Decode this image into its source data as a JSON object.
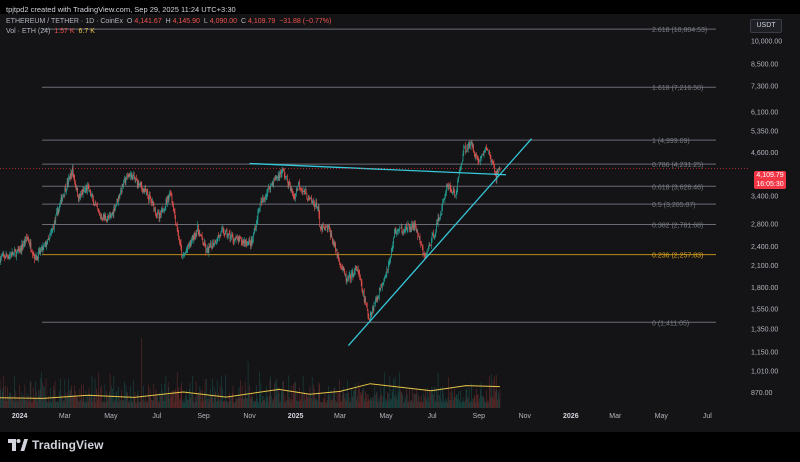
{
  "header": {
    "attribution": "tpjtpd2 created with TradingView.com, Sep 29, 2025 11:24 UTC+3:30"
  },
  "legend": {
    "symbol": "ETHEREUM / TETHER · 1D · CoinEx",
    "open_label": "O",
    "open": "4,141.67",
    "high_label": "H",
    "high": "4,145.90",
    "low_label": "L",
    "low": "4,090.00",
    "close_label": "C",
    "close": "4,109.79",
    "change": "−31.88 (−0.77%)",
    "volume_label": "Vol · ETH (24)",
    "volume": "1.57 K",
    "volume_ma": "6.7 K"
  },
  "currency": "USDT",
  "last_price": {
    "price": "4,109.79",
    "countdown": "16:05:30"
  },
  "price_axis": {
    "scale": "log",
    "ticks": [
      "10,000.00",
      "8,500.00",
      "7,300.00",
      "6,100.00",
      "5,350.00",
      "4,600.00",
      "3,400.00",
      "2,800.00",
      "2,400.00",
      "2,100.00",
      "1,800.00",
      "1,550.00",
      "1,350.00",
      "1,150.00",
      "1,010.00",
      "870.00"
    ]
  },
  "time_axis": {
    "labels": [
      "2024",
      "Mar",
      "May",
      "Jul",
      "Sep",
      "Nov",
      "2025",
      "Mar",
      "May",
      "Jul",
      "Sep",
      "Nov",
      "2026",
      "Mar",
      "May",
      "Jul"
    ]
  },
  "fibonacci": [
    {
      "label": "2.618 (10,804.53)",
      "price": 10804.53,
      "color": "#787b86"
    },
    {
      "label": "1.618 (7,216.50)",
      "price": 7216.5,
      "color": "#787b86"
    },
    {
      "label": "1 (4,999.09)",
      "price": 4999.09,
      "color": "#787b86"
    },
    {
      "label": "0.786 (4,231.25)",
      "price": 4231.25,
      "color": "#787b86"
    },
    {
      "label": "0.618 (3,628.46)",
      "price": 3628.46,
      "color": "#787b86"
    },
    {
      "label": "0.5 (3,205.07)",
      "price": 3205.07,
      "color": "#787b86"
    },
    {
      "label": "0.382 (2,781.68)",
      "price": 2781.68,
      "color": "#787b86"
    },
    {
      "label": "0.236 (2,257.83)",
      "price": 2257.83,
      "color": "#d9a11e"
    },
    {
      "label": "0 (1,411.05)",
      "price": 1411.05,
      "color": "#787b86"
    }
  ],
  "trendlines": [
    {
      "name": "descending-resistance",
      "from": [
        "2024-11-01",
        4250
      ],
      "to": [
        "2025-10-07",
        3930
      ],
      "color": "#36c7d9"
    },
    {
      "name": "ascending-support",
      "from": [
        "2025-03-12",
        1200
      ],
      "to": [
        "2025-11-10",
        5050
      ],
      "color": "#36c7d9"
    }
  ],
  "chart_data": {
    "type": "candlestick",
    "scale": "log",
    "ylim": [
      800,
      12000
    ],
    "xlim": [
      "2023-12-06",
      "2026-08-20"
    ],
    "colors": {
      "up": "#26a69a",
      "down": "#ef5350",
      "volume_ma": "#e8c547"
    },
    "price_path": [
      [
        "2023-12-06",
        2200
      ],
      [
        "2024-01-01",
        2300
      ],
      [
        "2024-01-12",
        2550
      ],
      [
        "2024-01-23",
        2200
      ],
      [
        "2024-02-10",
        2500
      ],
      [
        "2024-02-28",
        3400
      ],
      [
        "2024-03-12",
        4050
      ],
      [
        "2024-03-20",
        3350
      ],
      [
        "2024-04-01",
        3600
      ],
      [
        "2024-04-17",
        2950
      ],
      [
        "2024-05-01",
        2900
      ],
      [
        "2024-05-20",
        3750
      ],
      [
        "2024-05-27",
        3950
      ],
      [
        "2024-06-10",
        3650
      ],
      [
        "2024-06-24",
        3300
      ],
      [
        "2024-07-05",
        2900
      ],
      [
        "2024-07-20",
        3500
      ],
      [
        "2024-08-05",
        2200
      ],
      [
        "2024-08-25",
        2700
      ],
      [
        "2024-09-06",
        2300
      ],
      [
        "2024-09-27",
        2650
      ],
      [
        "2024-10-15",
        2500
      ],
      [
        "2024-11-05",
        2450
      ],
      [
        "2024-11-15",
        3150
      ],
      [
        "2024-12-01",
        3700
      ],
      [
        "2024-12-16",
        4050
      ],
      [
        "2024-12-31",
        3350
      ],
      [
        "2025-01-06",
        3700
      ],
      [
        "2025-01-20",
        3300
      ],
      [
        "2025-02-01",
        3150
      ],
      [
        "2025-02-03",
        2700
      ],
      [
        "2025-02-15",
        2700
      ],
      [
        "2025-02-28",
        2200
      ],
      [
        "2025-03-11",
        1880
      ],
      [
        "2025-03-25",
        2050
      ],
      [
        "2025-04-09",
        1450
      ],
      [
        "2025-04-25",
        1800
      ],
      [
        "2025-05-08",
        2200
      ],
      [
        "2025-05-13",
        2650
      ],
      [
        "2025-06-10",
        2750
      ],
      [
        "2025-06-22",
        2200
      ],
      [
        "2025-07-03",
        2550
      ],
      [
        "2025-07-15",
        3100
      ],
      [
        "2025-07-22",
        3700
      ],
      [
        "2025-08-02",
        3400
      ],
      [
        "2025-08-13",
        4700
      ],
      [
        "2025-08-24",
        4850
      ],
      [
        "2025-09-01",
        4300
      ],
      [
        "2025-09-13",
        4750
      ],
      [
        "2025-09-25",
        3900
      ],
      [
        "2025-09-29",
        4110
      ]
    ],
    "volume_ma": [
      [
        "2023-12-06",
        3.2
      ],
      [
        "2024-02-01",
        3.0
      ],
      [
        "2024-04-01",
        4.0
      ],
      [
        "2024-06-01",
        3.3
      ],
      [
        "2024-08-05",
        5.0
      ],
      [
        "2024-10-01",
        3.4
      ],
      [
        "2024-12-10",
        5.8
      ],
      [
        "2025-01-20",
        4.3
      ],
      [
        "2025-03-01",
        5.2
      ],
      [
        "2025-04-10",
        7.6
      ],
      [
        "2025-05-20",
        6.5
      ],
      [
        "2025-06-30",
        5.4
      ],
      [
        "2025-08-15",
        7.0
      ],
      [
        "2025-09-29",
        6.7
      ]
    ]
  }
}
